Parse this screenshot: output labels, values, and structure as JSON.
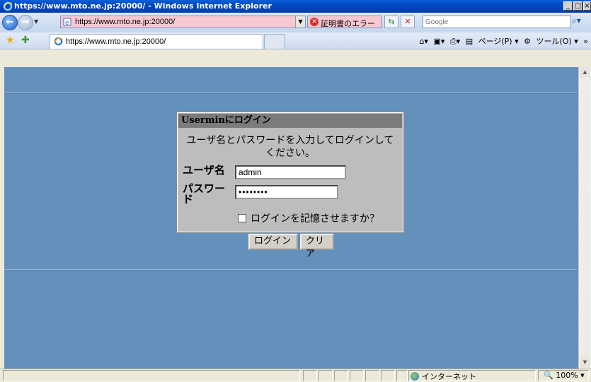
{
  "window": {
    "title": "https://www.mto.ne.jp:20000/ - Windows Internet Explorer"
  },
  "address": {
    "url": "https://www.mto.ne.jp:20000/",
    "cert_error": "証明書のエラー"
  },
  "search": {
    "placeholder": "Google"
  },
  "tab": {
    "label": "https://www.mto.ne.jp:20000/"
  },
  "commandbar": {
    "page": "ページ(P)",
    "tools": "ツール(O)"
  },
  "login": {
    "heading": "Userminにログイン",
    "message": "ユーザ名とパスワードを入力してログインしてください。",
    "username_label": "ユーザ名",
    "username_value": "admin",
    "password_label": "パスワード",
    "password_value": "••••••••",
    "remember_label": "ログインを記憶させますか？",
    "login_button": "ログイン",
    "clear_button": "クリア"
  },
  "statusbar": {
    "zone": "インターネット",
    "zoom": "100%"
  },
  "colors": {
    "page_background": "#6391bb",
    "panel": "#bdbdbd",
    "panel_header": "#7b7b7b"
  }
}
